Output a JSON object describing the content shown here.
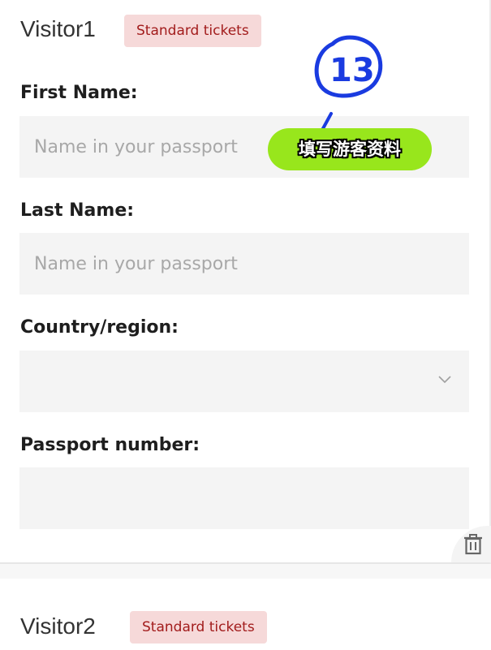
{
  "visitors": [
    {
      "title": "Visitor1",
      "badge": "Standard tickets",
      "fields": {
        "first_name": {
          "label": "First Name:",
          "placeholder": "Name in your passport",
          "value": ""
        },
        "last_name": {
          "label": "Last Name:",
          "placeholder": "Name in your passport",
          "value": ""
        },
        "country": {
          "label": "Country/region:",
          "value": ""
        },
        "passport": {
          "label": "Passport number:",
          "value": ""
        }
      }
    },
    {
      "title": "Visitor2",
      "badge": "Standard tickets"
    }
  ],
  "overlay": {
    "step_number": "13",
    "caption": "填写游客资料"
  },
  "icons": {
    "delete": "trash-icon",
    "dropdown": "chevron-down-icon"
  },
  "colors": {
    "badge_bg": "#f6d9d9",
    "badge_text": "#a21c1c",
    "field_bg": "#f4f4f4",
    "sticker_green": "#98e61c",
    "annotation_blue": "#1a3be0"
  }
}
